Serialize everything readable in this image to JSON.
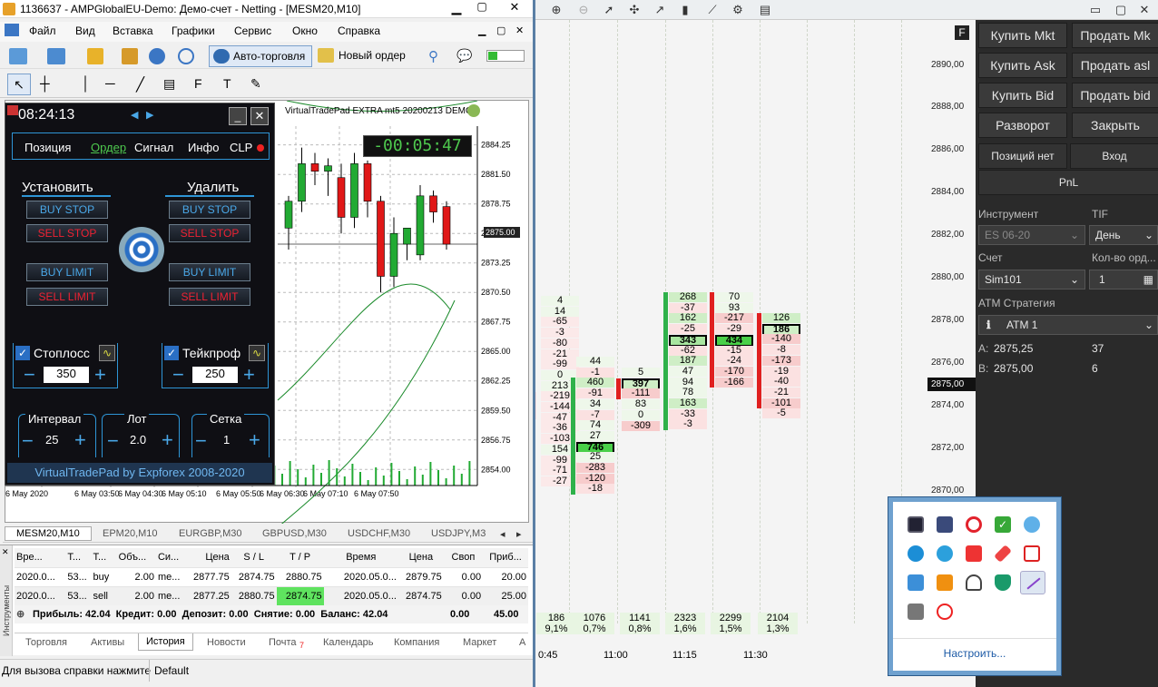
{
  "mt5": {
    "title": "1136637 - AMPGlobalEU-Demo: Демо-счет - Netting - [MESM20,M10]",
    "menu": [
      "Файл",
      "Вид",
      "Вставка",
      "Графики",
      "Сервис",
      "Окно",
      "Справка"
    ],
    "autotrade": "Авто-торговля",
    "neworder": "Новый ордер",
    "chart_header": "VirtualTradePad EXTRA mt5 20200213 DEMO",
    "countdown": "-00:05:47",
    "price_label": "2875.00",
    "price_ticks": [
      "2884.25",
      "2881.50",
      "2878.75",
      "2876.00",
      "2873.25",
      "2870.50",
      "2867.75",
      "2865.00",
      "2862.25",
      "2859.50",
      "2856.75",
      "2854.00"
    ],
    "time_ticks": [
      "6 May 2020",
      "6 May 03:50",
      "6 May 04:30",
      "6 May 05:10",
      "6 May 05:50",
      "6 May 06:30",
      "6 May 07:10",
      "6 May 07:50"
    ],
    "symbol_tabs": [
      "MESM20,M10",
      "EPM20,M10",
      "EURGBP,M30",
      "GBPUSD,M30",
      "USDCHF,M30",
      "USDJPY,M3"
    ],
    "table_headers": [
      "Вре...",
      "Т...",
      "Т...",
      "Объ...",
      "Си...",
      "Цена",
      "S / L",
      "T / P",
      "Время",
      "Цена",
      "Своп",
      "Приб..."
    ],
    "rows": [
      [
        "2020.0...",
        "53...",
        "buy",
        "2.00",
        "me...",
        "2877.75",
        "2874.75",
        "2880.75",
        "2020.05.0...",
        "2879.75",
        "0.00",
        "20.00"
      ],
      [
        "2020.0...",
        "53...",
        "sell",
        "2.00",
        "me...",
        "2877.25",
        "2880.75",
        "2874.75",
        "2020.05.0...",
        "2874.75",
        "0.00",
        "25.00"
      ]
    ],
    "summary": "Прибыль: 42.04  Кредит: 0.00  Депозит: 0.00  Снятие: 0.00  Баланс: 42.04",
    "summary_swap": "0.00",
    "summary_profit": "45.00",
    "side_label": "Инструменты",
    "bottom_tabs": [
      "Торговля",
      "Активы",
      "История",
      "Новости",
      "Почта",
      "Календарь",
      "Компания",
      "Маркет",
      "А"
    ],
    "mail_badge": "7",
    "status_left": "Для вызова справки нажмите",
    "status_right": "Default"
  },
  "vtp": {
    "time": "08:24:13",
    "tabs": [
      "Позиция",
      "Ордер",
      "Сигнал",
      "Инфо",
      "CLP"
    ],
    "set_label": "Установить",
    "del_label": "Удалить",
    "buy_stop": "BUY STOP",
    "sell_stop": "SELL STOP",
    "buy_limit": "BUY LIMIT",
    "sell_limit": "SELL LIMIT",
    "sl_label": "Стоплосс",
    "sl_value": "350",
    "tp_label": "Тейкпроф",
    "tp_value": "250",
    "interval_label": "Интервал",
    "interval_value": "25",
    "lot_label": "Лот",
    "lot_value": "2.0",
    "grid_label": "Сетка",
    "grid_value": "1",
    "footer": "VirtualTradePad by Expforex 2008-2020"
  },
  "ladder": {
    "price_ticks": [
      "2890,00",
      "2888,00",
      "2886,00",
      "2884,00",
      "2882,00",
      "2880,00",
      "2878,00",
      "2876,00",
      "2874,00",
      "2872,00",
      "2870,00"
    ],
    "current_price": "2875,00",
    "time_labels": [
      "0:45",
      "11:00",
      "11:15",
      "11:30"
    ],
    "volumes": [
      [
        "186",
        "9,1%"
      ],
      [
        "1076",
        "0,7%"
      ],
      [
        "1141",
        "0,8%"
      ],
      [
        "2323",
        "1,6%"
      ],
      [
        "2299",
        "1,5%"
      ],
      [
        "2104",
        "1,3%"
      ]
    ],
    "col1": [
      "4",
      "14",
      "-65",
      "-3",
      "-80",
      "-21",
      "-99",
      "0",
      "213",
      "-219",
      "-144",
      "-47",
      "-36",
      "-103",
      "154",
      "-99",
      "-71",
      "-27"
    ],
    "col2": [
      "44",
      "-1",
      "460",
      "-91",
      "34",
      "-7",
      "74",
      "27",
      "746",
      "25",
      "-283",
      "-120",
      "-18"
    ],
    "col3": [
      "5",
      "397",
      "-111",
      "83",
      "0",
      "-309"
    ],
    "col4": [
      "268",
      "-37",
      "162",
      "-25",
      "343",
      "-62",
      "187",
      "47",
      "94",
      "78",
      "163",
      "-33",
      "-3"
    ],
    "col5": [
      "70",
      "93",
      "-217",
      "-29",
      "434",
      "-15",
      "-24",
      "-170",
      "-166"
    ],
    "col6": [
      "126",
      "186",
      "-140",
      "-8",
      "-173",
      "-19",
      "-40",
      "-21",
      "-101",
      "-5"
    ]
  },
  "panel": {
    "buttons": [
      [
        "Купить Mkt",
        "Продать Mk"
      ],
      [
        "Купить Ask",
        "Продать asl"
      ],
      [
        "Купить Bid",
        "Продать bid"
      ],
      [
        "Разворот",
        "Закрыть"
      ]
    ],
    "pos_none": "Позиций нет",
    "entry": "Вход",
    "pnl": "PnL",
    "instrument_label": "Инструмент",
    "tif_label": "TIF",
    "instrument_value": "ES 06-20",
    "tif_value": "День",
    "account_label": "Счет",
    "qty_label": "Кол-во орд...",
    "account_value": "Sim101",
    "qty_value": "1",
    "atm_label": "ATM Стратегия",
    "atm_value": "ATM 1",
    "ask_label": "A:",
    "ask_value": "2875,25",
    "ask_size": "37",
    "bid_label": "B:",
    "bid_value": "2875,00",
    "bid_size": "6",
    "f_badge": "F"
  },
  "tray": {
    "configure": "Настроить..."
  }
}
